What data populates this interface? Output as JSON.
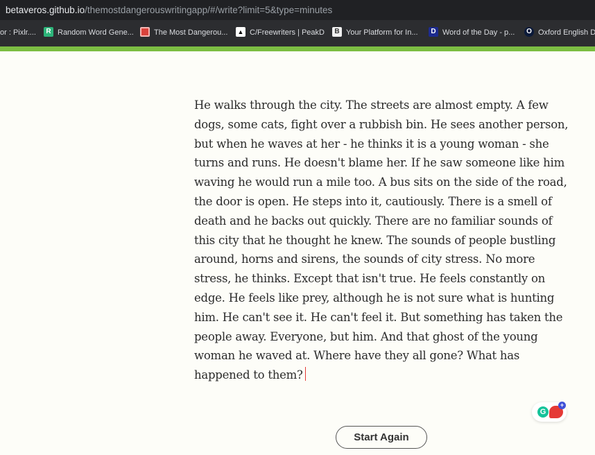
{
  "browser": {
    "url_host": "betaveros.github.io",
    "url_rest": "/themostdangerouswritingapp/#/write?limit=5&type=minutes"
  },
  "bookmarks": [
    {
      "label": "or : Pixlr....",
      "icon": "none"
    },
    {
      "label": "Random Word Gene...",
      "icon": "random-word-icon",
      "icon_text": "R",
      "icon_color": "#2db57a"
    },
    {
      "label": "The Most Dangerou...",
      "icon": "dangerous-writing-icon",
      "icon_text": "",
      "icon_color": "#d9423b"
    },
    {
      "label": "C/Freewriters | PeakD",
      "icon": "peakd-icon",
      "icon_text": "▲",
      "icon_color": "#ffffff"
    },
    {
      "label": "Your Platform for In...",
      "icon": "platform-icon",
      "icon_text": "B",
      "icon_color": "#f1f1f1"
    },
    {
      "label": "Word of the Day - p...",
      "icon": "dictionary-icon",
      "icon_text": "D",
      "icon_color": "#1c2a8e"
    },
    {
      "label": "Oxford English Dic...",
      "icon": "oxford-icon",
      "icon_text": "O",
      "icon_color": "#0b1a3a"
    }
  ],
  "session": {
    "progress_fraction": 1.0
  },
  "editor": {
    "text": "He walks through the city. The streets are almost empty. A few dogs, some cats, fight over a rubbish bin. He sees another person, but when he waves at her - he thinks it is a young woman - she turns and runs. He doesn't blame her. If he saw someone like him waving he would run a mile too. A bus sits on the side of the road, the door is open. He steps into it, cautiously. There is a smell of death and he backs out quickly. There are no familiar sounds of this city that he thought he knew. The sounds of people bustling around, horns and sirens, the sounds of city stress. No more stress, he thinks. Except that isn't true. He feels constantly on edge. He feels like prey, although he is not sure what is hunting him. He can't see it. He can't feel it. But something has taken the people away. Everyone, but him. And that ghost of the young woman he waved at. Where have they all gone? What has happened to them?"
  },
  "extension": {
    "grammarly_glyph": "G",
    "plus_glyph": "+"
  },
  "actions": {
    "start_again_label": "Start Again"
  }
}
